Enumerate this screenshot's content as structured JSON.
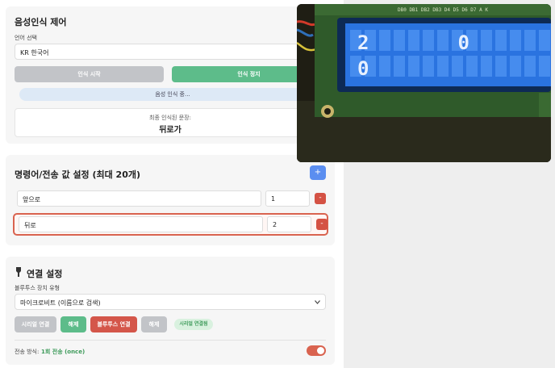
{
  "voice": {
    "title": "음성인식 제어",
    "language_label": "언어 선택",
    "language_value": "KR 한국어",
    "start_button": "인식 시작",
    "stop_button": "인식 정지",
    "status_text": "음성 인식 중...",
    "result_label": "최종 인식된 문장:",
    "result_text": "뒤로가"
  },
  "commands": {
    "title": "명령어/전송 값 설정 (최대 20개)",
    "add_button": "+",
    "rows": [
      {
        "command": "앞으로",
        "value": "1",
        "remove": "-"
      },
      {
        "command": "뒤로",
        "value": "2",
        "remove": "-"
      }
    ]
  },
  "connection": {
    "title": "연결 설정",
    "device_type_label": "블루투스 장치 유형",
    "device_type_value": "마이크로비트 (이름으로 검색)",
    "serial_connect": "시리얼 연결",
    "disconnect1": "해제",
    "bt_connect": "블루투스 연결",
    "disconnect2": "해제",
    "serial_status": "시리얼 연결됨",
    "transmit_label": "전송 방식:",
    "transmit_value": "1회 전송 (once)"
  },
  "lcd": {
    "header_pins": "DB0 DB1 DB2 DB3 D4 D5 D6 D7 A K",
    "line1": "20",
    "line2": "0"
  },
  "colors": {
    "blue_button": "#5b8ef0",
    "green_button": "#5dbc8a",
    "red_button": "#d4564a",
    "gray_button": "#c2c4c8",
    "accent_green": "#3d9a5a"
  }
}
